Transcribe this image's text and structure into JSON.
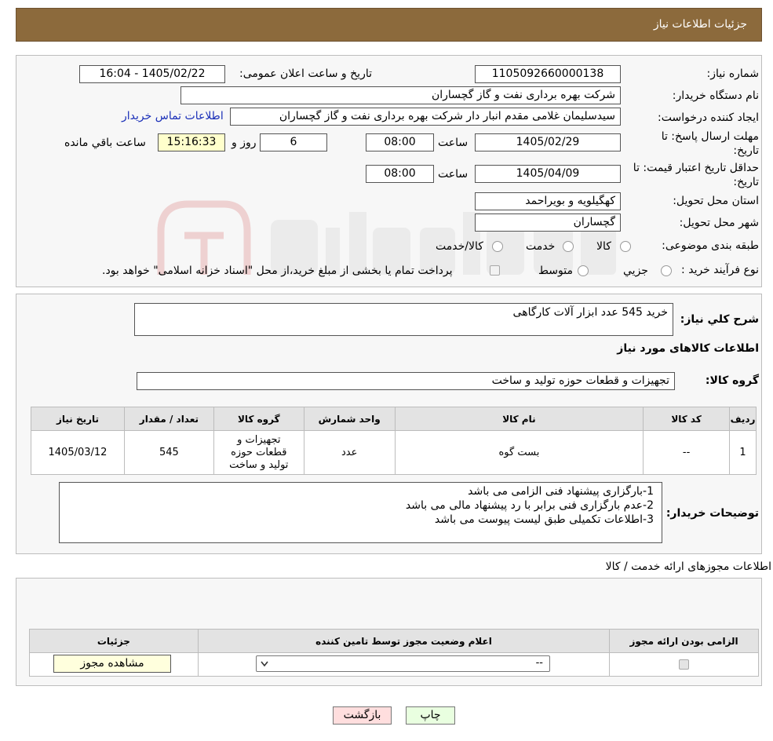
{
  "header": {
    "title": "جزئیات اطلاعات نیاز"
  },
  "form": {
    "need_number_label": "شماره نیاز:",
    "need_number": "1105092660000138",
    "announce_label": "تاریخ و ساعت اعلان عمومی:",
    "announce_value": "1405/02/22 - 16:04",
    "buyer_org_label": "نام دستگاه خریدار:",
    "buyer_org": "شرکت بهره برداری نفت و گاز گچساران",
    "requester_label": "ایجاد کننده درخواست:",
    "requester": "سیدسلیمان غلامی مقدم انبار دار شرکت بهره برداری نفت و گاز گچساران",
    "contact_link": "اطلاعات تماس خریدار",
    "deadline_label_1": "مهلت ارسال پاسخ: تا",
    "deadline_label_2": "تاریخ:",
    "deadline_date": "1405/02/29",
    "hour_label": "ساعت",
    "deadline_time": "08:00",
    "days_value": "6",
    "days_label": "روز و",
    "remaining_time": "15:16:33",
    "remaining_label": "ساعت باقي مانده",
    "validity_label_1": "حداقل تاریخ اعتبار قیمت: تا",
    "validity_label_2": "تاریخ:",
    "validity_date": "1405/04/09",
    "validity_time": "08:00",
    "province_label": "استان محل تحویل:",
    "province": "کهگیلویه و بویراحمد",
    "city_label": "شهر محل تحویل:",
    "city": "گچساران",
    "category_label": "طبقه بندی موضوعی:",
    "category_options": [
      "کالا",
      "خدمت",
      "کالا/خدمت"
    ],
    "process_label": "نوع فرآیند خرید :",
    "process_options": [
      "جزیي",
      "متوسط"
    ],
    "process_note": "پرداخت تمام یا بخشی از مبلغ خرید،از محل \"اسناد خزانه اسلامی\" خواهد بود."
  },
  "summary": {
    "desc_label": "شرح کلي نیاز:",
    "desc_value": "خرید 545 عدد ابزار آلات کارگاهی",
    "goods_info_title": "اطلاعات کالاهای مورد نیاز",
    "group_label": "گروه کالا:",
    "group_value": "تجهیزات و قطعات حوزه تولید و ساخت",
    "table": {
      "headers": [
        "ردیف",
        "کد کالا",
        "نام کالا",
        "واحد شمارش",
        "گروه کالا",
        "تعداد / مقدار",
        "تاریخ نیاز"
      ],
      "row": [
        "1",
        "--",
        "بست گوه",
        "عدد",
        "تجهیزات و قطعات حوزه تولید و ساخت",
        "545",
        "1405/03/12"
      ]
    },
    "buyer_notes_label": "توضیحات خریدار:",
    "buyer_notes": [
      "1-بارگزاری پیشنهاد فنی الزامی می باشد",
      "2-عدم بارگزاری فنی برابر با رد پیشنهاد مالی می باشد",
      "3-اطلاعات تکمیلی طبق لیست پیوست می باشد"
    ]
  },
  "permits": {
    "title": "اطلاعات مجوزهای ارائه خدمت / کالا",
    "headers": [
      "الزامی بودن ارائه مجوز",
      "اعلام وضعیت مجوز توسط تامین کننده",
      "جزئیات"
    ],
    "select_value": "--",
    "view_button": "مشاهده مجوز"
  },
  "buttons": {
    "print": "چاپ",
    "back": "بازگشت"
  },
  "colors": {
    "header": "#8c6a3c",
    "panel": "#f7f7f7",
    "back_button": "#ffdede",
    "print_button": "#e9ffe0",
    "link": "#1a2fb8"
  }
}
